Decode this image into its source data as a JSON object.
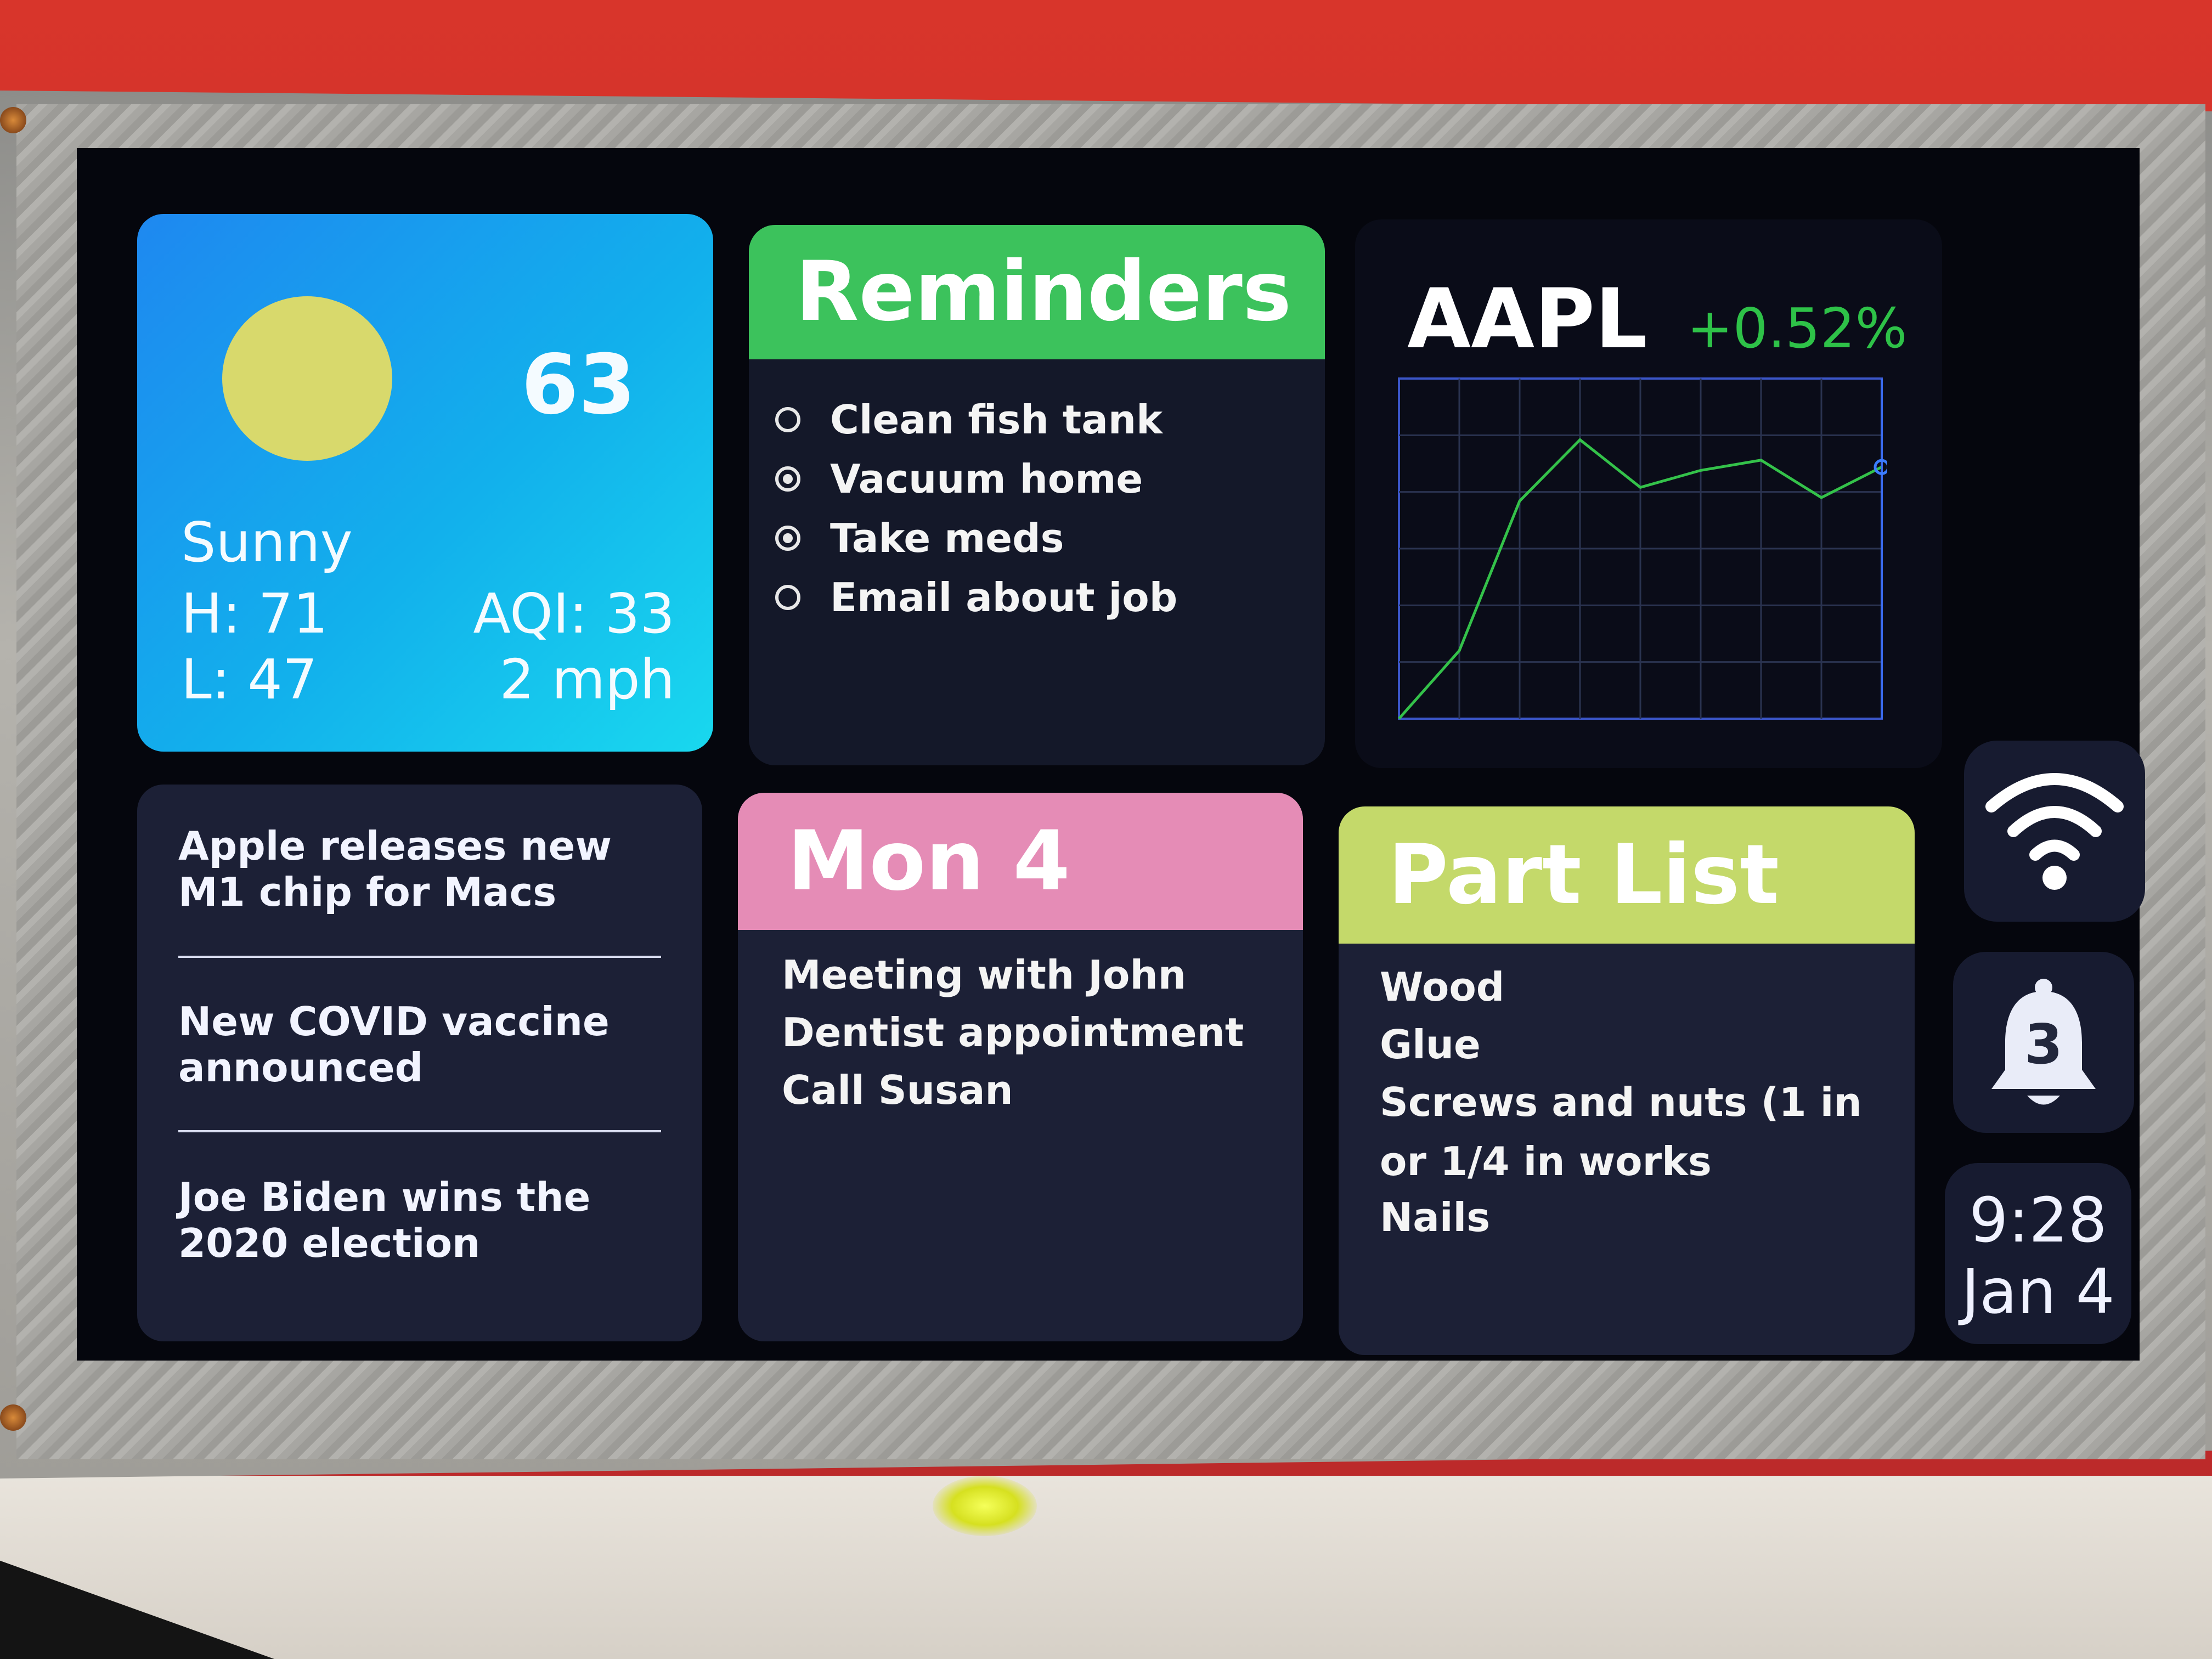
{
  "weather": {
    "temperature": "63",
    "condition": "Sunny",
    "high": "H: 71",
    "low": "L: 47",
    "aqi": "AQI: 33",
    "wind": "2 mph"
  },
  "reminders": {
    "title": "Reminders",
    "items": [
      {
        "label": "Clean fish tank",
        "checked": false
      },
      {
        "label": "Vacuum home",
        "checked": true
      },
      {
        "label": "Take meds",
        "checked": true
      },
      {
        "label": "Email about job",
        "checked": false
      }
    ],
    "accent": "#3cc25c"
  },
  "stock": {
    "ticker": "AAPL",
    "change": "+0.52%",
    "change_color": "#2ec248"
  },
  "chart_data": {
    "type": "line",
    "title": "",
    "x": [
      0,
      1,
      2,
      3,
      4,
      5,
      6,
      7,
      8
    ],
    "series": [
      {
        "values": [
          0.0,
          0.2,
          0.64,
          0.82,
          0.68,
          0.73,
          0.76,
          0.65,
          0.74
        ]
      }
    ],
    "ylim": [
      0,
      1
    ],
    "grid": true,
    "line_color": "#34c24a",
    "marker": "last-point"
  },
  "news": {
    "items": [
      "Apple releases new M1 chip for Macs",
      "New COVID vaccine announced",
      "Joe Biden wins the 2020 election"
    ]
  },
  "calendar": {
    "title": "Mon 4",
    "events": [
      "Meeting with John",
      "Dentist appointment",
      "Call Susan"
    ],
    "accent": "#e58cb6"
  },
  "parts": {
    "title": "Part List",
    "items": [
      "Wood",
      "Glue",
      "Screws and nuts (1 in or 1/4 in works",
      "Nails"
    ],
    "accent": "#c4d96a"
  },
  "status": {
    "wifi_icon": "wifi-icon",
    "bell_icon": "bell-icon",
    "notification_count": "3",
    "time": "9:28",
    "date": "Jan 4"
  }
}
